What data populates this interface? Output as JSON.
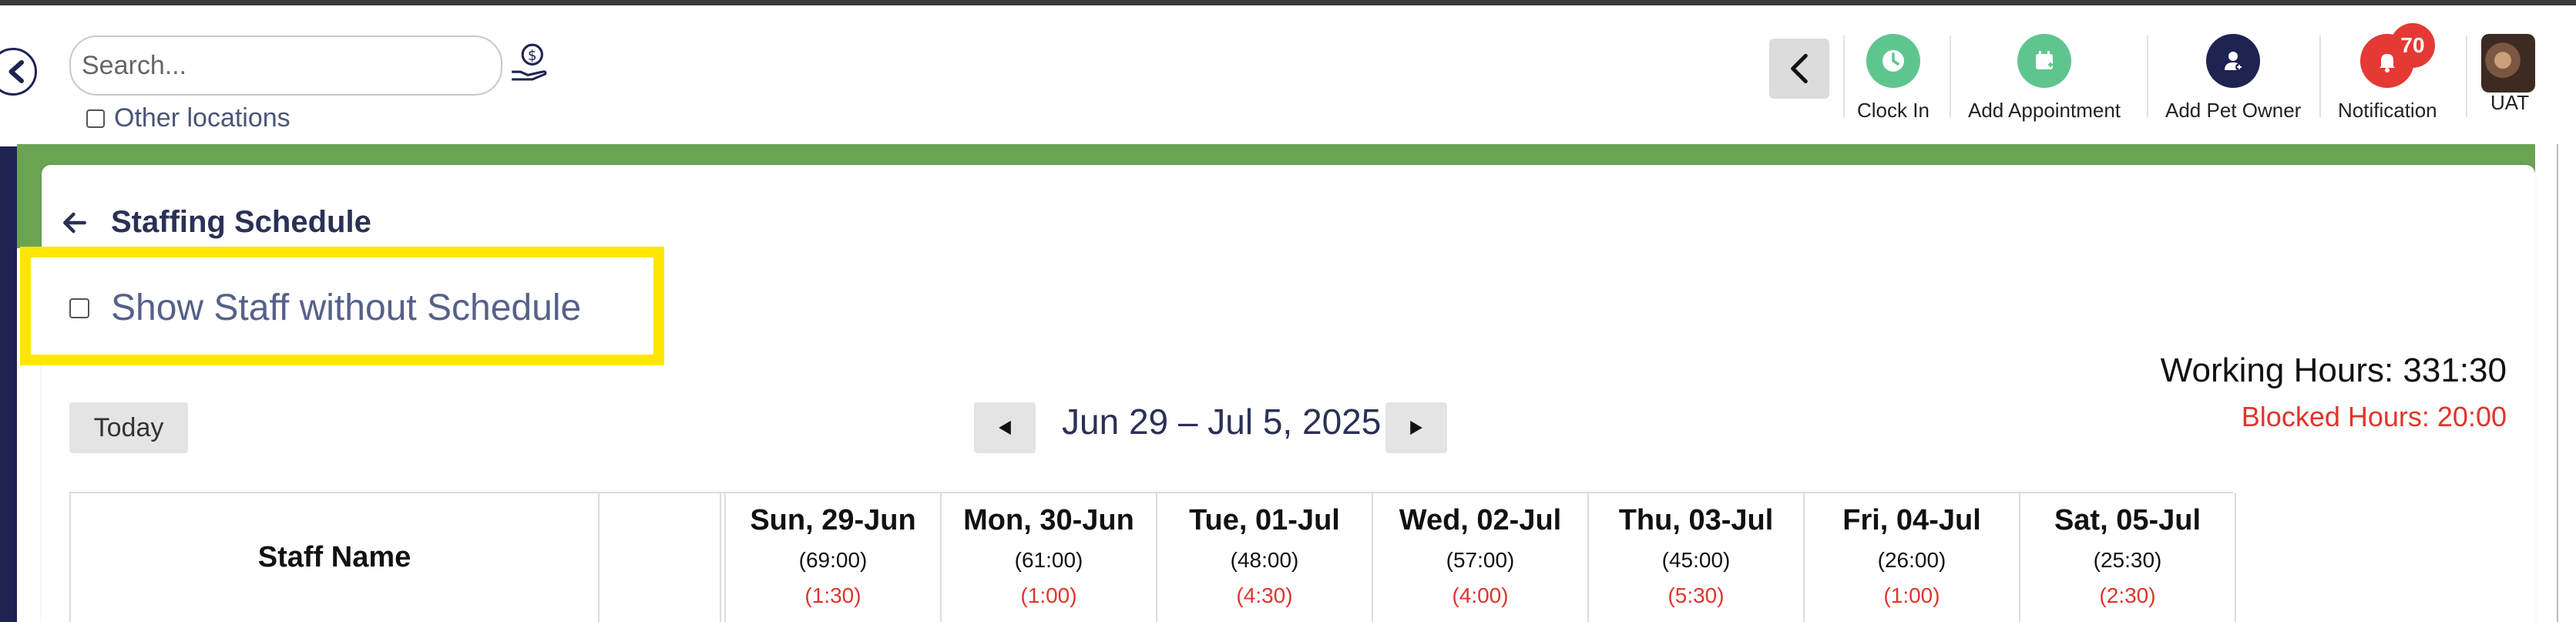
{
  "search": {
    "placeholder": "Search..."
  },
  "other_locations_label": "Other locations",
  "header_actions": [
    {
      "label": "Clock In",
      "color": "#5fc58f",
      "icon": "clock-icon"
    },
    {
      "label": "Add Appointment",
      "color": "#5fc58f",
      "icon": "calendar-plus-icon"
    },
    {
      "label": "Add Pet Owner",
      "color": "#1f2352",
      "icon": "user-plus-icon"
    },
    {
      "label": "Notification",
      "color": "#e53935",
      "icon": "bell-icon"
    }
  ],
  "notification_count": "70",
  "user_label": "UAT",
  "page": {
    "title": "Staffing Schedule",
    "show_staff_label": "Show Staff without Schedule",
    "working_hours": "Working Hours: 331:30",
    "blocked_hours": "Blocked Hours: 20:00",
    "today_label": "Today",
    "date_range": "Jun 29 – Jul 5, 2025"
  },
  "table": {
    "staff_header": "Staff Name",
    "days": [
      {
        "name": "Sun, 29-Jun",
        "hours": "(69:00)",
        "blocked": "(1:30)"
      },
      {
        "name": "Mon, 30-Jun",
        "hours": "(61:00)",
        "blocked": "(1:00)"
      },
      {
        "name": "Tue, 01-Jul",
        "hours": "(48:00)",
        "blocked": "(4:30)"
      },
      {
        "name": "Wed, 02-Jul",
        "hours": "(57:00)",
        "blocked": "(4:00)"
      },
      {
        "name": "Thu, 03-Jul",
        "hours": "(45:00)",
        "blocked": "(5:30)"
      },
      {
        "name": "Fri, 04-Jul",
        "hours": "(26:00)",
        "blocked": "(1:00)"
      },
      {
        "name": "Sat, 05-Jul",
        "hours": "(25:30)",
        "blocked": "(2:30)"
      }
    ]
  },
  "colors": {
    "green_band": "#6aa352",
    "highlight": "#ffe600",
    "navy": "#1f2352",
    "blocked_red": "#e0352b"
  }
}
